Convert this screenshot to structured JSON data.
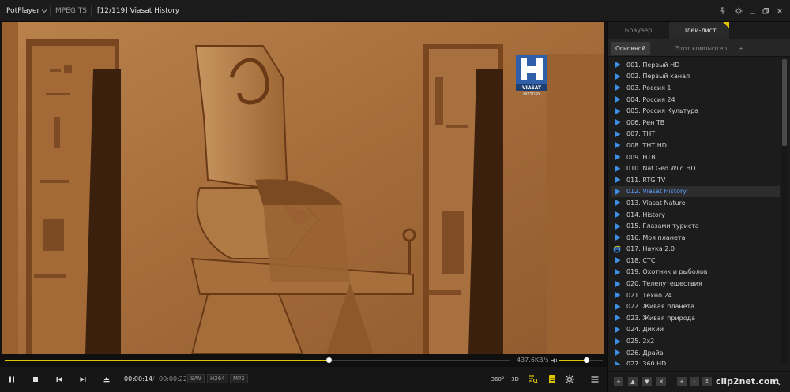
{
  "titlebar": {
    "app_name": "PotPlayer",
    "format": "MPEG TS",
    "title": "[12/119] Viasat History"
  },
  "video": {
    "channel_logo_text": "VIASAT",
    "channel_logo_sub": "HISTORY"
  },
  "seek": {
    "progress": 0.64,
    "bitrate": "437.6KB/s",
    "volume": 0.62
  },
  "controls": {
    "time_now": "00:00:14",
    "time_sep": "/",
    "time_total": "00:00:22",
    "tag_sw": "S/W",
    "tag_codec": "H264",
    "tag_audio": "MP2",
    "btn_360": "360°",
    "btn_3d": "3D"
  },
  "panel": {
    "tab_browser": "Браузер",
    "tab_playlist": "Плей-лист",
    "subtab_main": "Основной",
    "subtab_computer": "Этот компьютер",
    "subtab_add": "+",
    "items": [
      {
        "label": "001. Первый HD",
        "icon": "play"
      },
      {
        "label": "002. Первый канал",
        "icon": "play"
      },
      {
        "label": "003. Россия 1",
        "icon": "play"
      },
      {
        "label": "004. Россия 24",
        "icon": "play"
      },
      {
        "label": "005. Россия Культура",
        "icon": "play"
      },
      {
        "label": "006. Рен ТВ",
        "icon": "play"
      },
      {
        "label": "007. ТНТ",
        "icon": "play"
      },
      {
        "label": "008. ТНТ HD",
        "icon": "play"
      },
      {
        "label": "009. НТВ",
        "icon": "play"
      },
      {
        "label": "010. Nat Geo Wild HD",
        "icon": "play"
      },
      {
        "label": "011. RTG TV",
        "icon": "play"
      },
      {
        "label": "012. Viasat History",
        "icon": "play",
        "current": true
      },
      {
        "label": "013. Viasat Nature",
        "icon": "play"
      },
      {
        "label": "014. History",
        "icon": "play"
      },
      {
        "label": "015. Глазами туриста",
        "icon": "play"
      },
      {
        "label": "016. Моя планета",
        "icon": "play"
      },
      {
        "label": "017. Наука 2.0",
        "icon": "ie"
      },
      {
        "label": "018. СТС",
        "icon": "play"
      },
      {
        "label": "019. Охотник и рыболов",
        "icon": "play"
      },
      {
        "label": "020. Телепутешествия",
        "icon": "play"
      },
      {
        "label": "021. Техно 24",
        "icon": "play"
      },
      {
        "label": "022. Живая планета",
        "icon": "play"
      },
      {
        "label": "023. Живая природа",
        "icon": "play"
      },
      {
        "label": "024. Дикий",
        "icon": "play"
      },
      {
        "label": "025. 2x2",
        "icon": "play"
      },
      {
        "label": "026. Драйв",
        "icon": "play"
      },
      {
        "label": "027. 360 HD",
        "icon": "play"
      }
    ],
    "toolbar": [
      "+",
      "▲",
      "▼",
      "✕",
      "+",
      "-",
      "↕"
    ]
  },
  "watermark": "clip2net.com",
  "colors": {
    "accent": "#e0c400",
    "current_item": "#5ea0ff",
    "play_icon": "#3d8fe6"
  }
}
